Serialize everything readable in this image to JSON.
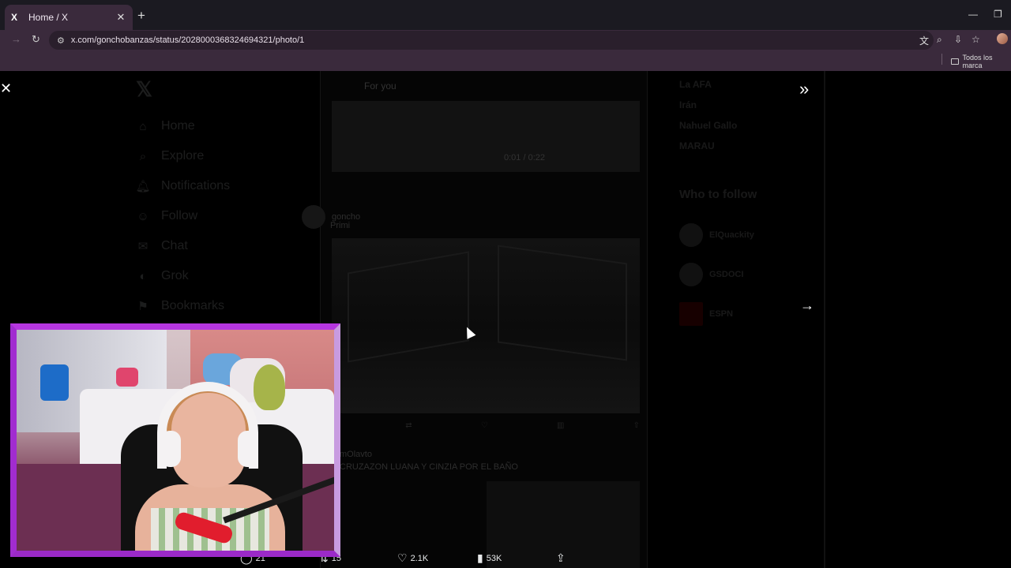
{
  "browser": {
    "tab_title": "Home / X",
    "tab_favicon": "X",
    "url": "x.com/gonchobanzas/status/2028000368324694321/photo/1",
    "bookmark_folder": "Todos los marca"
  },
  "viewer": {
    "close_icon": "✕",
    "expand_icon": "»",
    "next_icon": "→",
    "stats": {
      "replies": "21",
      "reposts": "15",
      "likes": "2.1K",
      "views": "53K"
    }
  },
  "background": {
    "nav": [
      "Home",
      "Explore",
      "Notifications",
      "Follow",
      "Chat",
      "Grok",
      "Bookmarks"
    ],
    "feed_tab": "For you",
    "video_time": "0:01 / 0:22",
    "tweet_author": "goncho",
    "tweet_text": "Primi",
    "reply_author": "mOlavto",
    "reply_text": "CRUZAZON LUANA Y CINZIA POR EL BAÑO",
    "trends": [
      {
        "name": "La AFA"
      },
      {
        "name": "Irán"
      },
      {
        "name": "Nahuel Gallo"
      },
      {
        "name": "MARAU"
      }
    ],
    "who_to_follow_title": "Who to follow",
    "who_to_follow": [
      "ElQuackity",
      "GSDOCI",
      "ESPN"
    ]
  },
  "colors": {
    "cam_border": "#b636e0",
    "chrome_dark": "#1b1a21",
    "chrome_tab": "#3a2a3c"
  }
}
